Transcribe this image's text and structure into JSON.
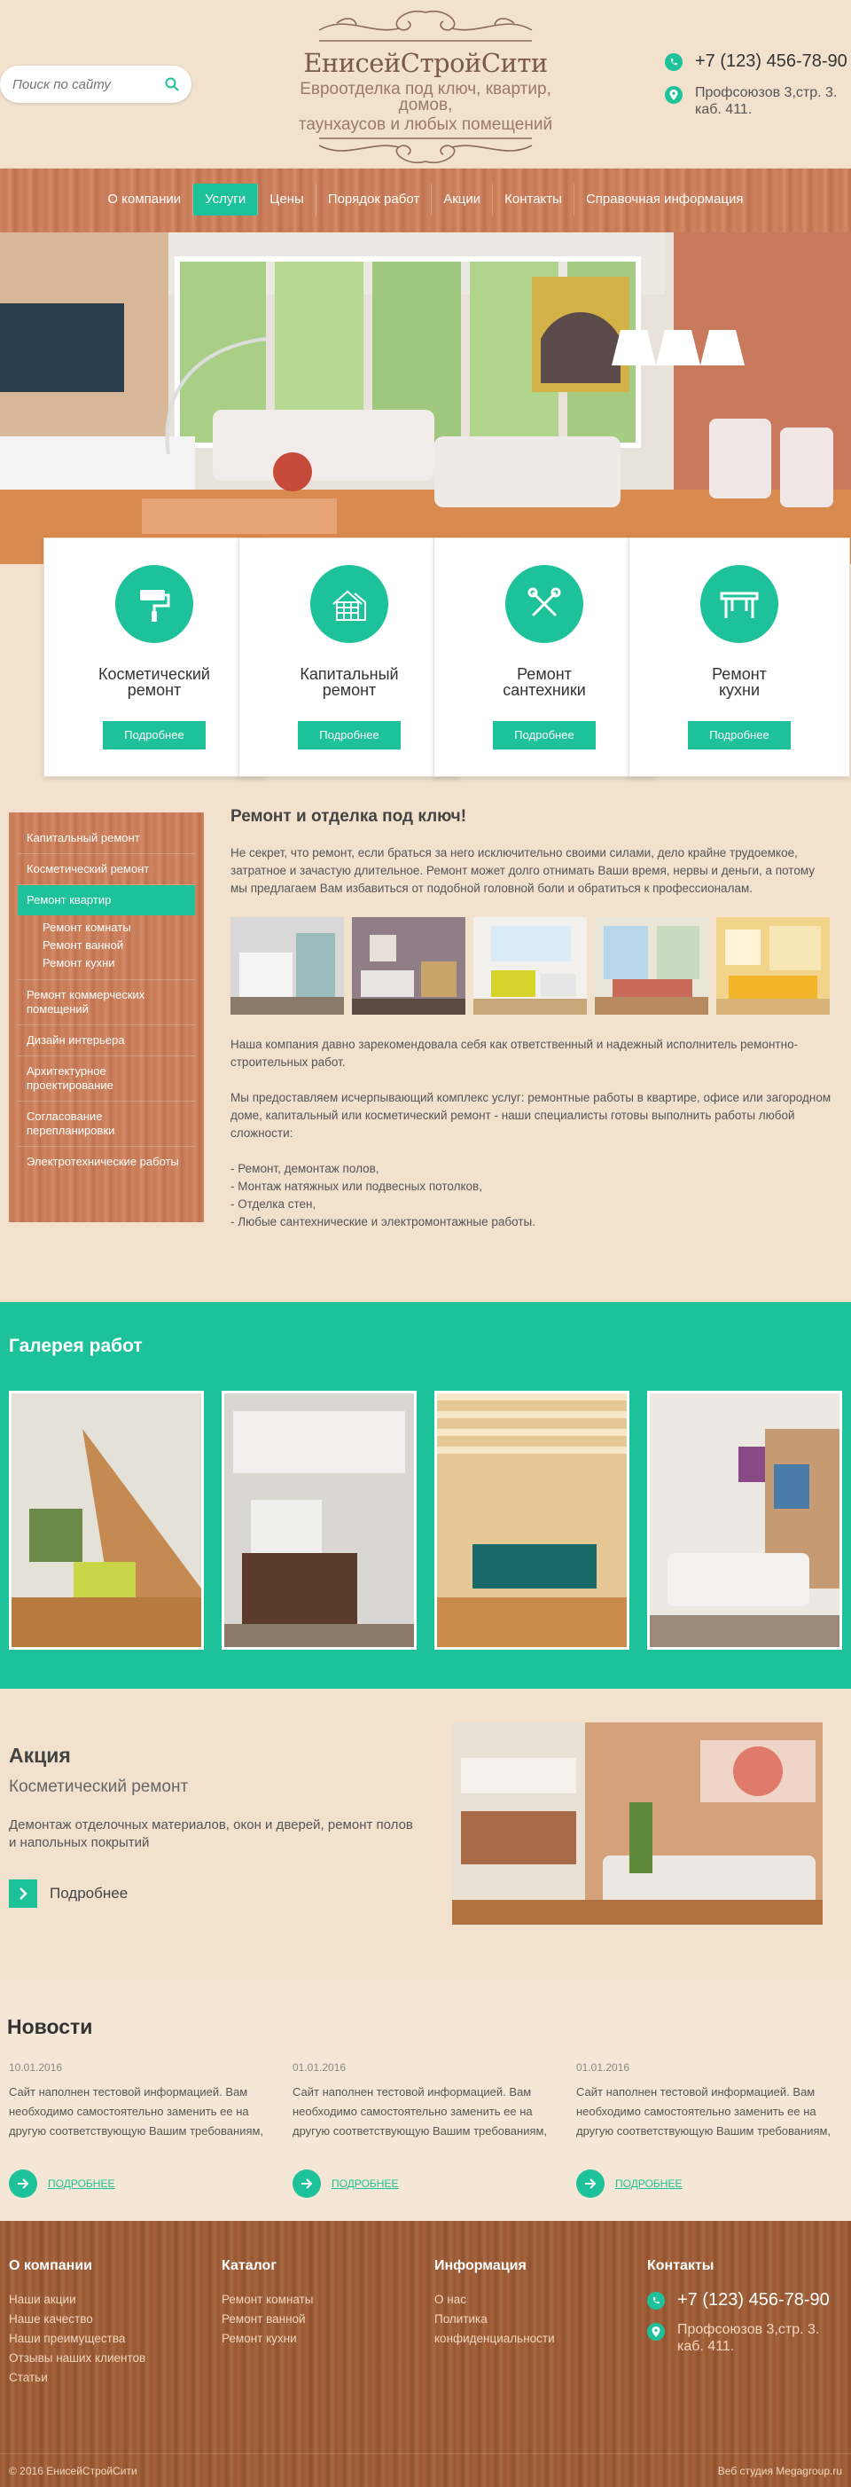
{
  "header": {
    "search_placeholder": "Поиск по сайту",
    "logo_title": "ЕнисейСтройСити",
    "logo_subtitle_1": "Евроотделка под ключ, квартир, домов,",
    "logo_subtitle_2": "таунхаусов и любых помещений",
    "phone": "+7 (123) 456-78-90",
    "address": "Профсоюзов 3,стр. 3. каб. 411."
  },
  "nav": {
    "items": [
      "О компании",
      "Услуги",
      "Цены",
      "Порядок работ",
      "Акции",
      "Контакты",
      "Справочная информация"
    ],
    "active": "Услуги"
  },
  "services": [
    {
      "icon": "paint-roller-icon",
      "title_1": "Косметический",
      "title_2": "ремонт",
      "button": "Подробнее"
    },
    {
      "icon": "house-icon",
      "title_1": "Капитальный",
      "title_2": "ремонт",
      "button": "Подробнее"
    },
    {
      "icon": "tools-icon",
      "title_1": "Ремонт",
      "title_2": "сантехники",
      "button": "Подробнее"
    },
    {
      "icon": "table-icon",
      "title_1": "Ремонт",
      "title_2": "кухни",
      "button": "Подробнее"
    }
  ],
  "sidebar": {
    "items": [
      "Капитальный ремонт",
      "Косметический ремонт",
      "Ремонт квартир",
      "Ремонт коммерческих помещений",
      "Дизайн интерьера",
      "Архитектурное проектирование",
      "Согласование перепланировки",
      "Электротехнические работы"
    ],
    "active": "Ремонт квартир",
    "subitems": [
      "Ремонт комнаты",
      "Ремонт ванной",
      "Ремонт кухни"
    ]
  },
  "content": {
    "title": "Ремонт и отделка под ключ!",
    "intro": "Не секрет, что ремонт, если браться за него исключительно своими силами, дело крайне трудоемкое, затратное и зачастую длительное. Ремонт может долго отнимать Ваши время, нервы и деньги, а потому мы предлагаем Вам избавиться от подобной головной боли и обратиться к профессионалам.",
    "para_1": "Наша компания давно зарекомендовала себя как ответственный и надежный исполнитель ремонтно-строительных работ.",
    "para_2": "Мы предоставляем исчерпывающий комплекс услуг: ремонтные работы в квартире, офисе или загородном доме, капитальный или косметический ремонт - наши специалисты готовы выполнить работы любой сложности:",
    "list": [
      "- Ремонт, демонтаж полов,",
      "- Монтаж натяжных или подвесных потолков,",
      "- Отделка стен,",
      "- Любые сантехнические и электромонтажные работы."
    ]
  },
  "gallery": {
    "title": "Галерея работ"
  },
  "promo": {
    "title": "Акция",
    "subtitle": "Косметический ремонт",
    "text": "Демонтаж отделочных материалов, окон и дверей, ремонт полов и напольных покрытий",
    "more": "Подробнее"
  },
  "news": {
    "title": "Новости",
    "items": [
      {
        "date": "10.01.2016",
        "text": "Сайт наполнен тестовой информацией. Вам необходимо самостоятельно заменить ее на другую соответствующую Вашим требованиям,",
        "more": "ПОДРОБНЕЕ"
      },
      {
        "date": "01.01.2016",
        "text": "Сайт наполнен тестовой информацией. Вам необходимо самостоятельно заменить ее на другую соответствующую Вашим требованиям,",
        "more": "ПОДРОБНЕЕ"
      },
      {
        "date": "01.01.2016",
        "text": "Сайт наполнен тестовой информацией. Вам необходимо самостоятельно заменить ее на другую соответствующую Вашим требованиям, сделать это можно через систему управления",
        "more": "ПОДРОБНЕЕ"
      }
    ]
  },
  "footer": {
    "col1": {
      "title": "О компании",
      "links": [
        "Наши акции",
        "Наше качество",
        "Наши преимущества",
        "Отзывы наших клиентов",
        "Статьи"
      ]
    },
    "col2": {
      "title": "Каталог",
      "links": [
        "Ремонт комнаты",
        "Ремонт ванной",
        "Ремонт кухни"
      ]
    },
    "col3": {
      "title": "Информация",
      "links": [
        "О нас",
        "Политика конфиденциальности"
      ]
    },
    "col4": {
      "title": "Контакты",
      "phone": "+7 (123) 456-78-90",
      "address": "Профсоюзов 3,стр. 3. каб. 411."
    },
    "copyright": "© 2016 ЕнисейСтройСити",
    "studio": "Веб студия Megagroup.ru"
  },
  "colors": {
    "accent": "#1ec29a",
    "background": "#f1e1cd",
    "wood": "#cd855f",
    "footer_wood": "#9c5a35"
  }
}
